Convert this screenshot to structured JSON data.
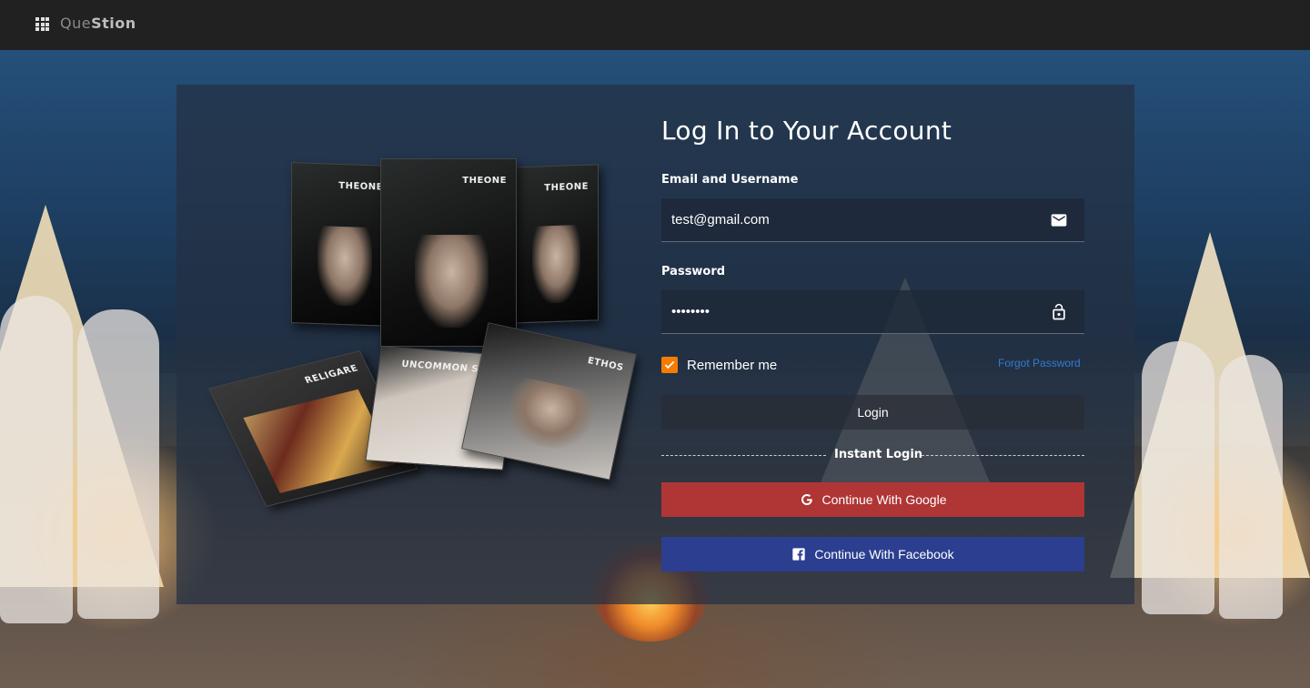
{
  "header": {
    "brand_part1": "Que",
    "brand_part2": "Stion",
    "apps_icon": "apps-grid-icon"
  },
  "illustration": {
    "books": [
      "THEONE",
      "THEONE",
      "THEONE",
      "RELIGARE",
      "UNCOMMON SENSE",
      "ETHOS"
    ]
  },
  "login": {
    "title": "Log In to Your Account",
    "email_label": "Email and Username",
    "email_value": "test@gmail.com",
    "email_icon": "mail-icon",
    "password_label": "Password",
    "password_value": "12345678",
    "password_icon": "lock-icon",
    "remember_label": "Remember me",
    "remember_checked": true,
    "forgot_label": "Forgot Password",
    "login_button": "Login",
    "instant_login_label": "Instant Login",
    "google_button": "Continue With Google",
    "facebook_button": "Continue With Facebook"
  },
  "colors": {
    "topbar": "#212121",
    "checkbox": "#f57c00",
    "forgot_link": "#2f7bd1",
    "google": "#b03535",
    "facebook": "#2b3e8f"
  }
}
